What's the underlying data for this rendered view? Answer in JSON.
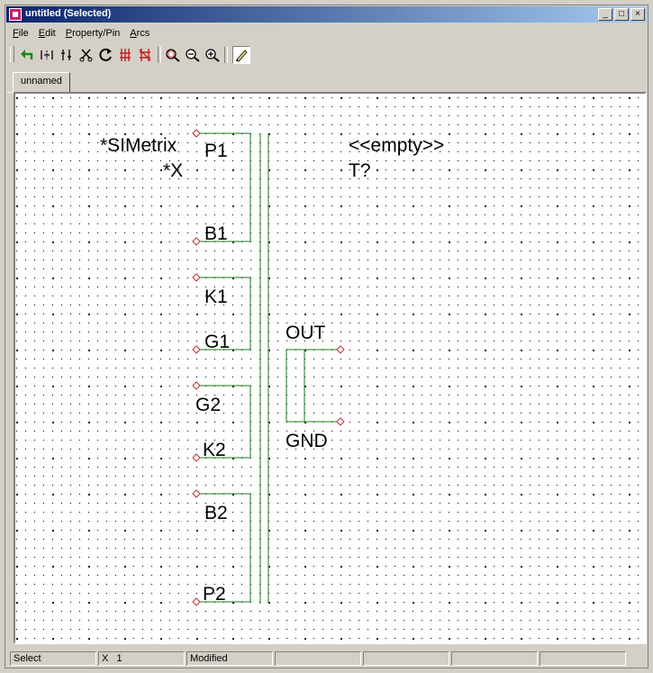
{
  "window": {
    "title": "untitled (Selected)"
  },
  "title_buttons": [
    "_",
    "□",
    "×"
  ],
  "menu": [
    {
      "label": "File",
      "u": "F",
      "rest": "ile"
    },
    {
      "label": "Edit",
      "u": "E",
      "rest": "dit"
    },
    {
      "label": "Property/Pin",
      "u": "P",
      "rest": "roperty/Pin"
    },
    {
      "label": "Arcs",
      "u": "A",
      "rest": "rcs"
    }
  ],
  "toolbar": {
    "icons": [
      "undo-icon",
      "flip-horizontal-icon",
      "flip-vertical-icon",
      "cut-icon",
      "rotate-icon",
      "pin-icon",
      "delete-pin-icon",
      "zoom-box-icon",
      "zoom-out-icon",
      "zoom-in-icon",
      "pencil-icon"
    ]
  },
  "tab": {
    "label": "unnamed"
  },
  "symbol": {
    "left_labels": [
      "*SIMetrix",
      "*X"
    ],
    "right_labels": [
      "<<empty>>",
      "T?"
    ],
    "pins": [
      "P1",
      "B1",
      "K1",
      "G1",
      "G2",
      "K2",
      "B2",
      "P2",
      "OUT",
      "GND"
    ]
  },
  "status": {
    "mode": "Select",
    "x_label": "X",
    "x_value": "1",
    "state": "Modified"
  },
  "colors": {
    "wire": "#1e7a1e",
    "pin_marker": "#c03030",
    "grid_dot": "#000000"
  }
}
